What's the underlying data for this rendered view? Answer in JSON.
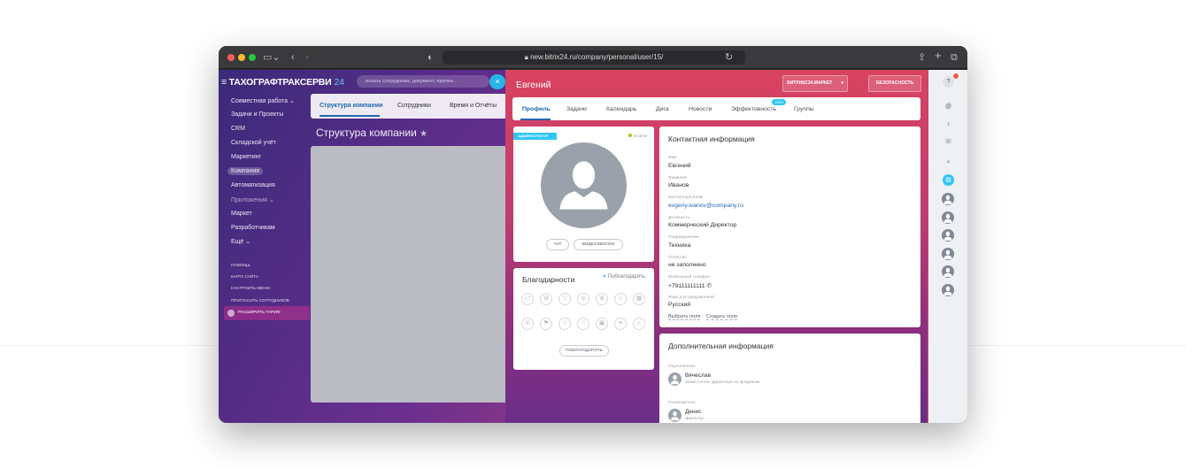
{
  "browser": {
    "url": "new.bitrix24.ru/company/personal/user/15/"
  },
  "portal": {
    "logo": "ТАХОГРАФТРАКСЕРВИ",
    "logo_suffix": "24",
    "search_placeholder": "искать сотрудника, документ, прочее...",
    "menu": [
      {
        "label": "Совместная работа ⌄"
      },
      {
        "label": "Задачи и Проекты"
      },
      {
        "label": "CRM"
      },
      {
        "label": "Складской учёт"
      },
      {
        "label": "Маркетинг"
      },
      {
        "label": "Компания"
      },
      {
        "label": "Автоматизация"
      },
      {
        "label": "Приложения ⌄"
      },
      {
        "label": "Маркет"
      },
      {
        "label": "Разработчикам"
      },
      {
        "label": "Ещё ⌄"
      }
    ],
    "small_menu": [
      "Помощь",
      "Карта сайта",
      "Настроить меню",
      "Пригласить сотрудников"
    ],
    "tariff": "Расширить тариф",
    "grid_tabs": [
      "Структура компании",
      "Сотрудники",
      "Время и Отчёты"
    ],
    "grid_title": "Структура компании"
  },
  "profile": {
    "name": "Евгений",
    "market_button": "Битрикс24.Маркет",
    "security_button": "Безопасность",
    "tabs": [
      "Профиль",
      "Задачи",
      "Календарь",
      "Диск",
      "Новости",
      "Эффективность",
      "Группы"
    ],
    "efficiency_badge": "100%",
    "admin_badge": "Администратор",
    "online": "В сети",
    "chat_button": "Чат",
    "video_button": "Видеозвонок",
    "thanks": {
      "title": "Благодарности",
      "thank_link": "Поблагодарить",
      "thank_button": "Поблагодарить",
      "icons": [
        "thumb-icon",
        "gift-icon",
        "cup-icon",
        "medal-icon",
        "crown-icon",
        "trophy-icon",
        "cake-icon",
        "one-icon",
        "flag-icon",
        "star-icon",
        "heart-icon",
        "beer-icon",
        "bulb-icon",
        "smile-icon"
      ]
    },
    "contact": {
      "title": "Контактная информация",
      "fields": [
        {
          "label": "Имя",
          "value": "Евгений"
        },
        {
          "label": "Фамилия",
          "value": "Иванов"
        },
        {
          "label": "Контактный Email",
          "value": "evgeny.ivanov@company.ru"
        },
        {
          "label": "Должность",
          "value": "Коммерческий Директор"
        },
        {
          "label": "Подразделение",
          "value": "Техника"
        },
        {
          "label": "Отчество",
          "value": "не заполнено"
        },
        {
          "label": "Мобильный телефон",
          "value": "+79111111111"
        },
        {
          "label": "Язык для уведомлений",
          "value": "Русский"
        }
      ],
      "select_fields": "Выбрать поля",
      "create_field": "Создать поле"
    },
    "additional": {
      "title": "Дополнительная информация",
      "subordinates_label": "Подчиненные",
      "subordinate_name": "Вячеслав",
      "subordinate_position": "Заместитель Директора по продажам",
      "manager_label": "Руководитель",
      "manager_name": "Денис",
      "manager_position": "Директор"
    }
  },
  "colors": {
    "accent": "#2fc6f6",
    "link": "#2067b0"
  }
}
